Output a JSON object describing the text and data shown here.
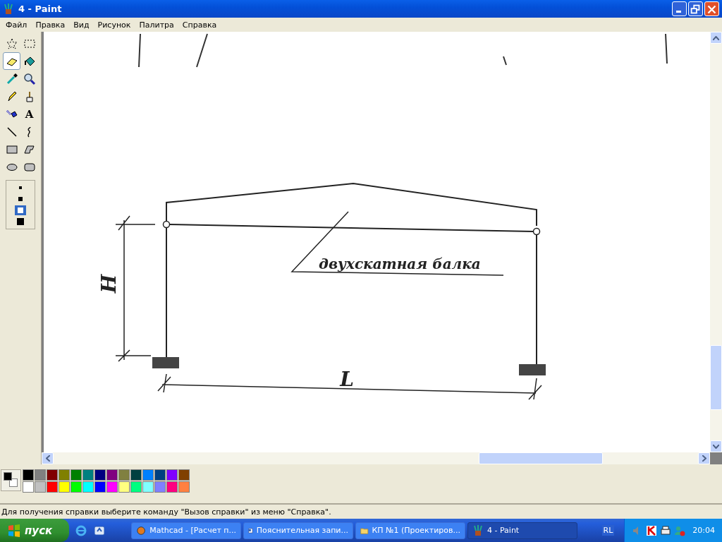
{
  "window": {
    "title": "4 - Paint"
  },
  "menu": [
    "Файл",
    "Правка",
    "Вид",
    "Рисунок",
    "Палитра",
    "Справка"
  ],
  "tools": [
    {
      "kind": "free-select",
      "selected": false
    },
    {
      "kind": "select",
      "selected": false
    },
    {
      "kind": "eraser",
      "selected": true
    },
    {
      "kind": "fill",
      "selected": false
    },
    {
      "kind": "picker",
      "selected": false
    },
    {
      "kind": "magnifier",
      "selected": false
    },
    {
      "kind": "pencil",
      "selected": false
    },
    {
      "kind": "brush",
      "selected": false
    },
    {
      "kind": "airbrush",
      "selected": false
    },
    {
      "kind": "text",
      "label": "A",
      "selected": false
    },
    {
      "kind": "line",
      "selected": false
    },
    {
      "kind": "curve",
      "selected": false
    },
    {
      "kind": "rect",
      "selected": false
    },
    {
      "kind": "polygon",
      "selected": false
    },
    {
      "kind": "ellipse",
      "selected": false
    },
    {
      "kind": "rounded-rect",
      "selected": false
    }
  ],
  "eraser_sizes": [
    {
      "selected": false
    },
    {
      "selected": false
    },
    {
      "selected": true
    },
    {
      "selected": false
    }
  ],
  "drawing": {
    "height_label": "H",
    "length_label": "L",
    "beam_label": "двухскатная балка"
  },
  "palette": {
    "colors": [
      {
        "color": "#000000"
      },
      {
        "color": "#808080"
      },
      {
        "color": "#800000"
      },
      {
        "color": "#808000"
      },
      {
        "color": "#008000"
      },
      {
        "color": "#008080"
      },
      {
        "color": "#000080"
      },
      {
        "color": "#800080"
      },
      {
        "color": "#808040"
      },
      {
        "color": "#004040"
      },
      {
        "color": "#0080ff"
      },
      {
        "color": "#004080"
      },
      {
        "color": "#8000ff"
      },
      {
        "color": "#804000"
      },
      {
        "color": "#ffffff"
      },
      {
        "color": "#c0c0c0"
      },
      {
        "color": "#ff0000"
      },
      {
        "color": "#ffff00"
      },
      {
        "color": "#00ff00"
      },
      {
        "color": "#00ffff"
      },
      {
        "color": "#0000ff"
      },
      {
        "color": "#ff00ff"
      },
      {
        "color": "#ffff80"
      },
      {
        "color": "#00ff80"
      },
      {
        "color": "#80ffff"
      },
      {
        "color": "#8080ff"
      },
      {
        "color": "#ff0080"
      },
      {
        "color": "#ff8040"
      }
    ]
  },
  "status_bar": "Для получения справки выберите команду \"Вызов справки\" из меню \"Справка\".",
  "taskbar": {
    "start": "пуск",
    "tasks": [
      {
        "kind": "mathcad",
        "label": "Mathcad - [Расчет п...",
        "selected": false
      },
      {
        "kind": "word",
        "label": "Пояснительная запи...",
        "selected": false
      },
      {
        "kind": "folder",
        "label": "КП №1 (Проектиров...",
        "selected": false
      },
      {
        "kind": "paint",
        "label": "4 - Paint",
        "selected": true
      }
    ],
    "language": "RL",
    "clock": "20:04"
  }
}
